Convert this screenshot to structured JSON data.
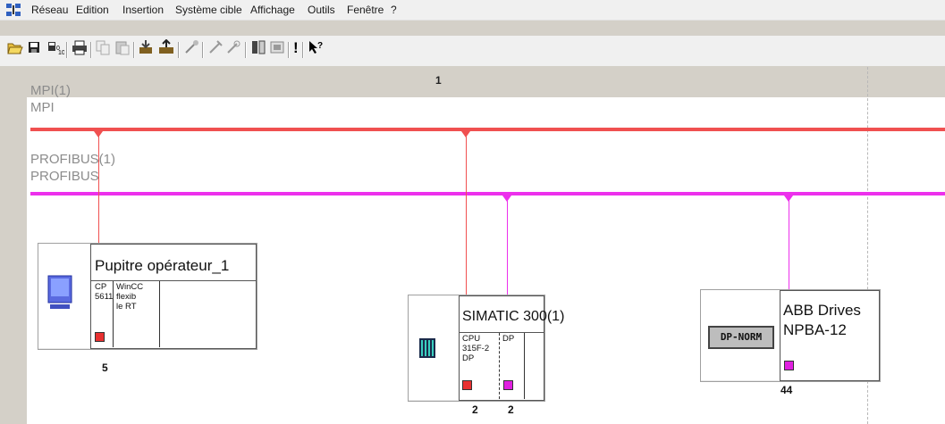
{
  "menubar": {
    "items": [
      "Réseau",
      "Edition",
      "Insertion",
      "Système cible",
      "Affichage",
      "Outils",
      "Fenêtre",
      "?"
    ]
  },
  "toolbar": {
    "buttons": [
      "open-icon",
      "save-icon",
      "download-icon",
      "print-icon",
      "copy-icon",
      "paste-icon",
      "load-icon",
      "upload-icon",
      "wizard-icon",
      "compile-icon",
      "check-icon",
      "properties-icon",
      "station-icon",
      "exclamation-icon",
      "help-pointer-icon"
    ],
    "help_label": "!"
  },
  "canvas": {
    "column_number": "1",
    "networks": [
      {
        "name": "MPI(1)",
        "type": "MPI",
        "color": "#f05050"
      },
      {
        "name": "PROFIBUS(1)",
        "type": "PROFIBUS",
        "color": "#ec30ec"
      }
    ],
    "stations": [
      {
        "title": "Pupitre opérateur_1",
        "slots": [
          {
            "text": "CP\n5611"
          },
          {
            "text": "WinCC\nflexib\nle RT"
          }
        ],
        "ports": [
          {
            "color": "#e83030",
            "address": "5"
          }
        ]
      },
      {
        "title": "SIMATIC 300(1)",
        "slots": [
          {
            "text": "CPU\n315F-2\nDP"
          },
          {
            "text": "DP"
          }
        ],
        "ports": [
          {
            "color": "#e83030",
            "address": "2"
          },
          {
            "color": "#e020e0",
            "address": "2"
          }
        ]
      },
      {
        "title": "ABB Drives",
        "subtitle": "NPBA-12",
        "device_label": "DP-NORM",
        "ports": [
          {
            "color": "#e020e0",
            "address": "44"
          }
        ]
      }
    ]
  }
}
